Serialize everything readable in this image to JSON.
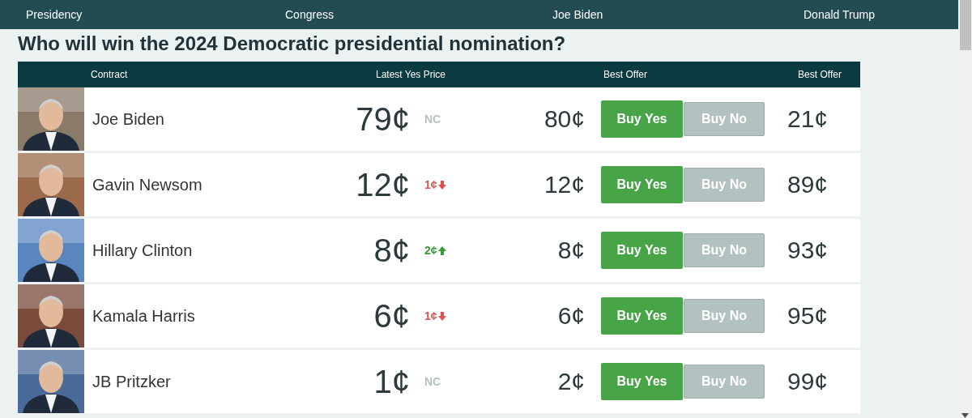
{
  "nav": {
    "items": [
      "Presidency",
      "Congress",
      "Joe Biden",
      "Donald Trump"
    ]
  },
  "heading": "Who will win the 2024 Democratic presidential nomination?",
  "table": {
    "columns": [
      "Contract",
      "Latest Yes Price",
      "Best Offer",
      "Best Offer"
    ],
    "rows": [
      {
        "name": "Joe Biden",
        "price": "79¢",
        "change": {
          "kind": "nc",
          "text": "NC"
        },
        "best_yes": "80¢",
        "buy_yes": "Buy Yes",
        "buy_no": "Buy No",
        "best_no": "21¢"
      },
      {
        "name": "Gavin Newsom",
        "price": "12¢",
        "change": {
          "kind": "down",
          "text": "1¢"
        },
        "best_yes": "12¢",
        "buy_yes": "Buy Yes",
        "buy_no": "Buy No",
        "best_no": "89¢"
      },
      {
        "name": "Hillary Clinton",
        "price": "8¢",
        "change": {
          "kind": "up",
          "text": "2¢"
        },
        "best_yes": "8¢",
        "buy_yes": "Buy Yes",
        "buy_no": "Buy No",
        "best_no": "93¢"
      },
      {
        "name": "Kamala Harris",
        "price": "6¢",
        "change": {
          "kind": "down",
          "text": "1¢"
        },
        "best_yes": "6¢",
        "buy_yes": "Buy Yes",
        "buy_no": "Buy No",
        "best_no": "95¢"
      },
      {
        "name": "JB Pritzker",
        "price": "1¢",
        "change": {
          "kind": "nc",
          "text": "NC"
        },
        "best_yes": "2¢",
        "buy_yes": "Buy Yes",
        "buy_no": "Buy No",
        "best_no": "99¢"
      }
    ]
  }
}
